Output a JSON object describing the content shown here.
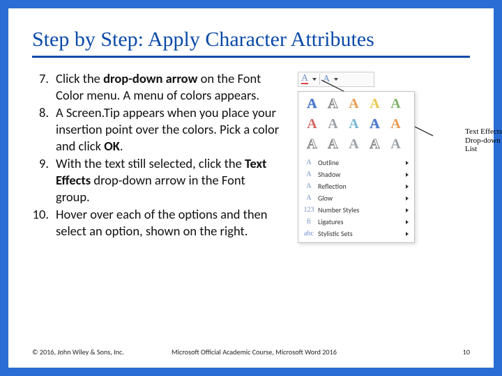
{
  "title": "Step by Step: Apply Character Attributes",
  "steps": [
    {
      "n": "7.",
      "html": "Click the <b>drop-down arrow</b> on the Font Color menu. A menu of colors appears."
    },
    {
      "n": "8.",
      "html": "A Screen.Tip appears when you place your insertion point over the colors. Pick a color and click <b>OK</b>."
    },
    {
      "n": "9.",
      "html": "With the text still selected, click the <b>Text Effects</b> drop-down arrow in the Font group."
    },
    {
      "n": "10.",
      "html": "Hover over each of the options and then select an option, shown on the right."
    }
  ],
  "figure": {
    "callout": "Text Effects Drop-down List",
    "glyph": "A",
    "menu": [
      {
        "label": "Outline"
      },
      {
        "label": "Shadow"
      },
      {
        "label": "Reflection"
      },
      {
        "label": "Glow"
      },
      {
        "label": "Number Styles"
      },
      {
        "label": "Ligatures"
      },
      {
        "label": "Stylistic Sets"
      }
    ]
  },
  "footer": {
    "copyright": "© 2016, John Wiley & Sons, Inc.",
    "course": "Microsoft Official Academic Course, Microsoft Word 2016",
    "page": "10"
  }
}
